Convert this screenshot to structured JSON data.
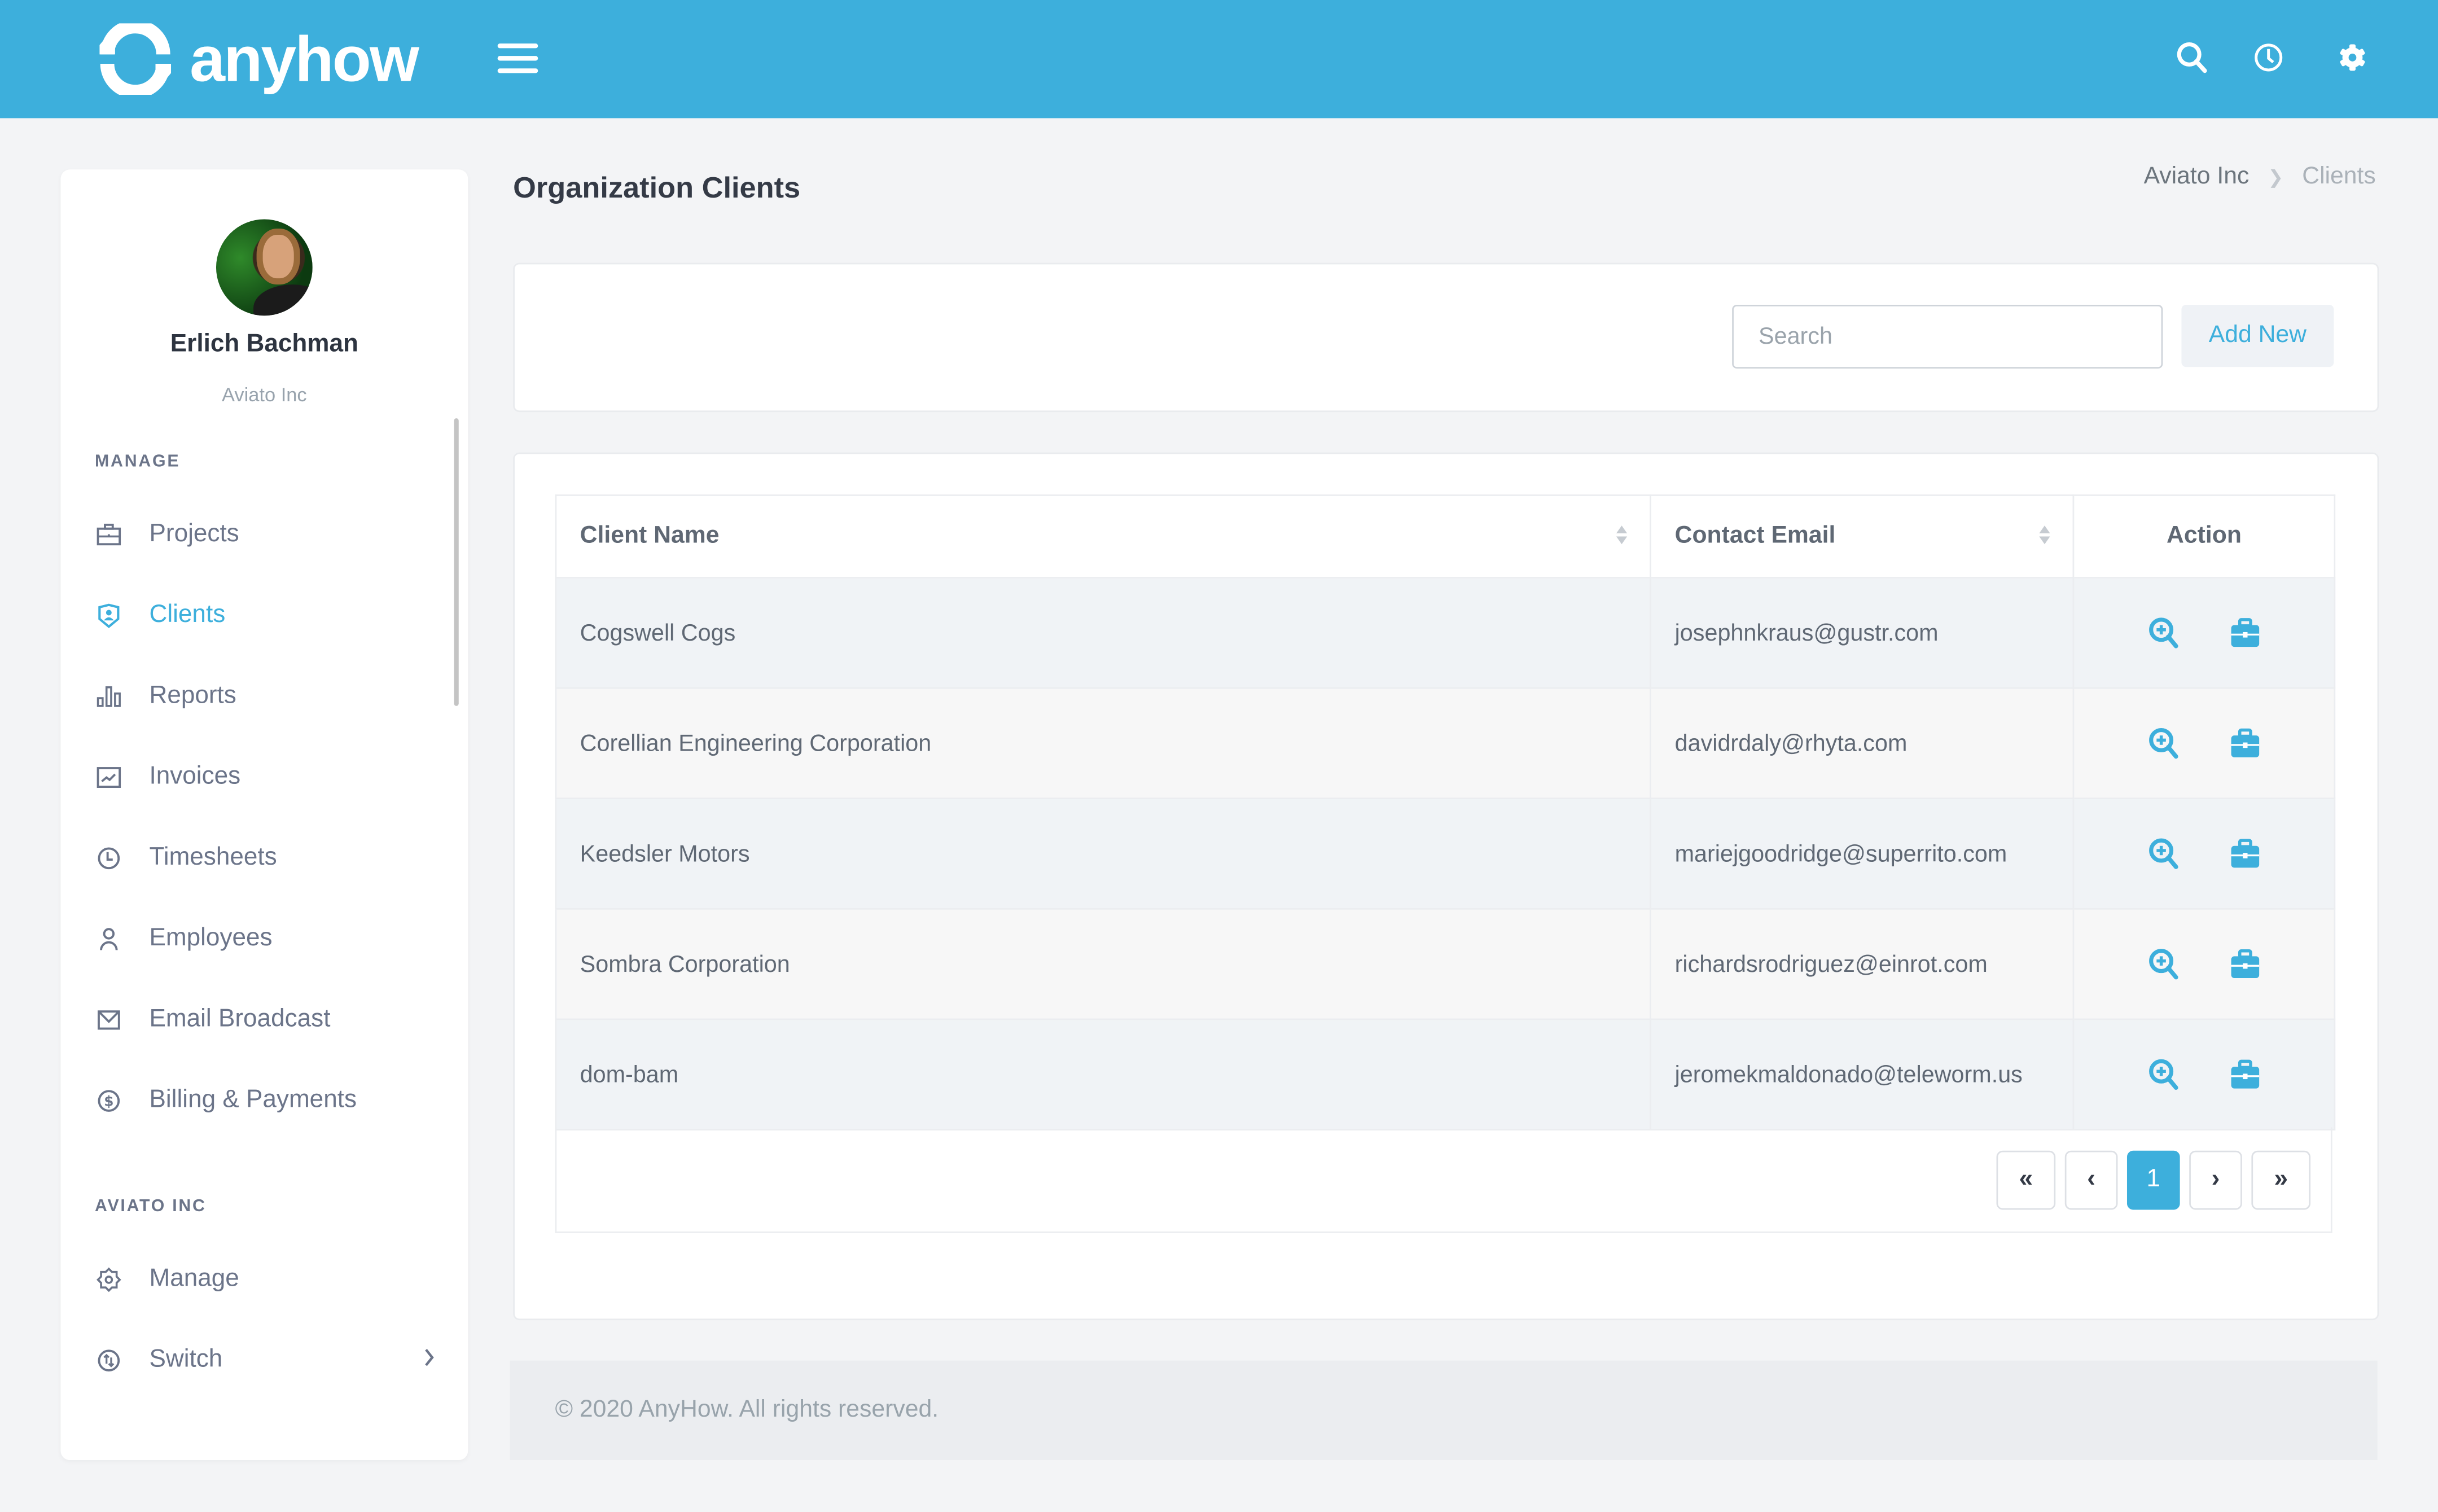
{
  "app": {
    "brand": "anyhow",
    "accent_color": "#3dafdc"
  },
  "topbar": {
    "icons": [
      "search-icon",
      "clock-icon",
      "gear-icon"
    ]
  },
  "sidebar": {
    "user": {
      "name": "Erlich Bachman",
      "org": "Aviato Inc"
    },
    "sections": [
      {
        "label": "MANAGE",
        "items": [
          {
            "label": "Projects",
            "icon": "briefcase-icon",
            "active": false
          },
          {
            "label": "Clients",
            "icon": "shield-user-icon",
            "active": true
          },
          {
            "label": "Reports",
            "icon": "bar-chart-icon",
            "active": false
          },
          {
            "label": "Invoices",
            "icon": "trend-chart-icon",
            "active": false
          },
          {
            "label": "Timesheets",
            "icon": "clock-icon",
            "active": false
          },
          {
            "label": "Employees",
            "icon": "user-icon",
            "active": false
          },
          {
            "label": "Email Broadcast",
            "icon": "mail-icon",
            "active": false
          },
          {
            "label": "Billing & Payments",
            "icon": "dollar-circle-icon",
            "active": false
          }
        ]
      },
      {
        "label": "AVIATO INC",
        "items": [
          {
            "label": "Manage",
            "icon": "cog-icon",
            "active": false
          },
          {
            "label": "Switch",
            "icon": "switch-arrows-icon",
            "active": false,
            "has_submenu": true
          }
        ]
      }
    ]
  },
  "page": {
    "title": "Organization Clients",
    "breadcrumb": [
      {
        "label": "Aviato Inc"
      },
      {
        "label": "Clients"
      }
    ]
  },
  "toolbar": {
    "search_placeholder": "Search",
    "search_value": "",
    "add_new_label": "Add New"
  },
  "table": {
    "columns": [
      "Client Name",
      "Contact Email",
      "Action"
    ],
    "rows": [
      {
        "name": "Cogswell Cogs",
        "email": "josephnkraus@gustr.com"
      },
      {
        "name": "Corellian Engineering Corporation",
        "email": "davidrdaly@rhyta.com"
      },
      {
        "name": "Keedsler Motors",
        "email": "mariejgoodridge@superrito.com"
      },
      {
        "name": "Sombra Corporation",
        "email": "richardsrodriguez@einrot.com"
      },
      {
        "name": "dom-bam",
        "email": "jeromekmaldonado@teleworm.us"
      }
    ]
  },
  "pagination": {
    "first": "«",
    "prev": "‹",
    "current": "1",
    "next": "›",
    "last": "»"
  },
  "footer": {
    "text": "© 2020 AnyHow. All rights reserved."
  }
}
